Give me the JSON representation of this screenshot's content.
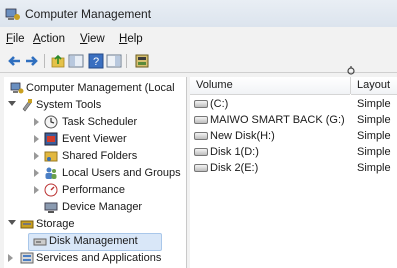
{
  "window": {
    "title": "Computer Management"
  },
  "menu": [
    {
      "label": "File",
      "underline": "F",
      "rest": "ile"
    },
    {
      "label": "Action",
      "underline": "A",
      "rest": "ction"
    },
    {
      "label": "View",
      "underline": "V",
      "rest": "iew"
    },
    {
      "label": "Help",
      "underline": "H",
      "rest": "elp"
    }
  ],
  "toolbar": {
    "icons": [
      "back-arrow-icon",
      "forward-arrow-icon",
      "up-folder-icon",
      "show-hide-tree-icon",
      "help-icon",
      "properties-icon",
      "export-icon"
    ]
  },
  "tree": {
    "root": "Computer Management (Local",
    "system_tools": "System Tools",
    "task_scheduler": "Task Scheduler",
    "event_viewer": "Event Viewer",
    "shared_folders": "Shared Folders",
    "local_users": "Local Users and Groups",
    "performance": "Performance",
    "device_manager": "Device Manager",
    "storage": "Storage",
    "disk_management": "Disk Management",
    "services": "Services and Applications"
  },
  "list": {
    "columns": {
      "volume": "Volume",
      "layout": "Layout"
    },
    "rows": [
      {
        "volume": "(C:)",
        "layout": "Simple"
      },
      {
        "volume": "MAIWO SMART BACK (G:)",
        "layout": "Simple"
      },
      {
        "volume": "New Disk(H:)",
        "layout": "Simple"
      },
      {
        "volume": "Disk 1(D:)",
        "layout": "Simple"
      },
      {
        "volume": "Disk 2(E:)",
        "layout": "Simple"
      }
    ]
  },
  "colors": {
    "selection": "#d9e7f8",
    "accent": "#3a6fb0"
  }
}
